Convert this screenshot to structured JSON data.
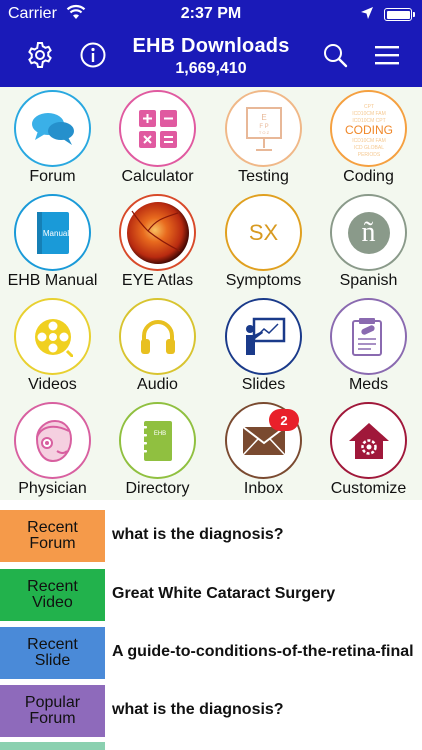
{
  "status_bar": {
    "carrier": "Carrier",
    "time": "2:37 PM"
  },
  "header": {
    "title": "EHB Downloads",
    "count": "1,669,410",
    "background": "#1a1ab8"
  },
  "grid": {
    "items": [
      {
        "label": "Forum",
        "icon": "chat-bubbles-icon",
        "color": "#29a8e0"
      },
      {
        "label": "Calculator",
        "icon": "calculator-icon",
        "color": "#e05aa0"
      },
      {
        "label": "Testing",
        "icon": "eye-chart-icon",
        "color": "#f0b888"
      },
      {
        "label": "Coding",
        "icon": "coding-icon",
        "color": "#f5a040"
      },
      {
        "label": "EHB Manual",
        "icon": "manual-book-icon",
        "color": "#1a9ad8"
      },
      {
        "label": "EYE Atlas",
        "icon": "retina-icon",
        "color": "#d84a2a"
      },
      {
        "label": "Symptoms",
        "icon": "symptoms-sx-icon",
        "color": "#e0a020"
      },
      {
        "label": "Spanish",
        "icon": "spanish-n-icon",
        "color": "#8a9a8a"
      },
      {
        "label": "Videos",
        "icon": "film-reel-icon",
        "color": "#e8d030"
      },
      {
        "label": "Audio",
        "icon": "headphones-icon",
        "color": "#d8c430"
      },
      {
        "label": "Slides",
        "icon": "presenter-icon",
        "color": "#1a3a8a"
      },
      {
        "label": "Meds",
        "icon": "prescription-icon",
        "color": "#8a6ab0"
      },
      {
        "label": "Physician",
        "icon": "physician-face-icon",
        "color": "#d860a0"
      },
      {
        "label": "Directory",
        "icon": "directory-book-icon",
        "color": "#90c040"
      },
      {
        "label": "Inbox",
        "icon": "envelope-icon",
        "color": "#7a4a30"
      },
      {
        "label": "Customize",
        "icon": "home-gear-icon",
        "color": "#a0183a"
      }
    ],
    "inbox_badge": "2",
    "coding_lines": [
      "CPT",
      "ICD10CM FAM",
      "ICD10CM CPT",
      "CODING",
      "ICD10CM FAM",
      "ICD GLOBAL",
      "PERIODS"
    ],
    "manual_text": "Manual",
    "symptoms_text": "SX",
    "spanish_text": "ñ",
    "directory_text": "EHB"
  },
  "list": {
    "rows": [
      {
        "tag_line1": "Recent",
        "tag_line2": "Forum",
        "text": "what is the diagnosis?",
        "color": "#f59a4a"
      },
      {
        "tag_line1": "Recent",
        "tag_line2": "Video",
        "text": "Great White Cataract Surgery",
        "color": "#22b24c"
      },
      {
        "tag_line1": "Recent",
        "tag_line2": "Slide",
        "text": "A guide-to-conditions-of-the-retina-final",
        "color": "#4a8ad8"
      },
      {
        "tag_line1": "Popular",
        "tag_line2": "Forum",
        "text": "what is the diagnosis?",
        "color": "#8e6abb"
      }
    ]
  }
}
